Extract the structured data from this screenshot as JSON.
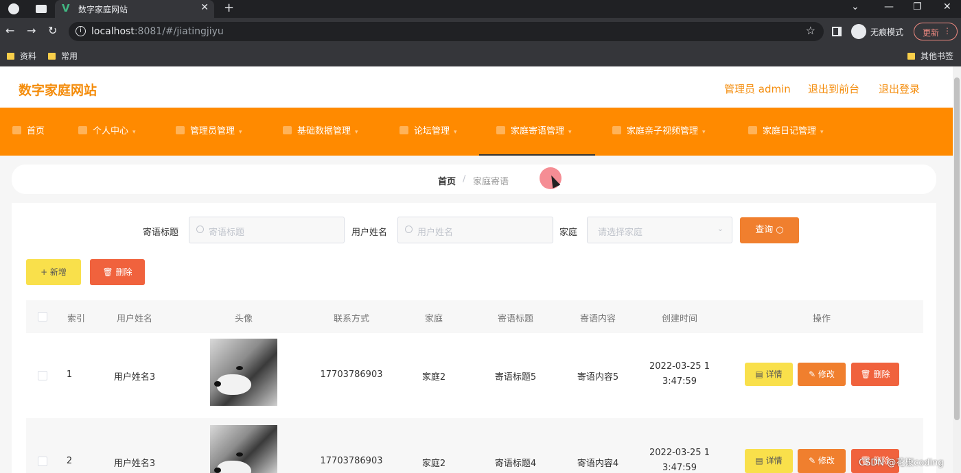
{
  "browser": {
    "tab_title": "数字家庭网站",
    "tab_close": "✕",
    "new_tab": "+",
    "url_host": "localhost",
    "url_rest": ":8081/#/jiatingjiyu",
    "incognito_label": "无痕模式",
    "update_label": "更新",
    "bookmarks": [
      "资料",
      "常用"
    ],
    "other_bookmarks": "其他书签"
  },
  "header": {
    "site_title": "数字家庭网站",
    "admin_label": "管理员 admin",
    "back_to_front": "退出到前台",
    "logout": "退出登录"
  },
  "menu": {
    "items": [
      {
        "label": "首页"
      },
      {
        "label": "个人中心"
      },
      {
        "label": "管理员管理"
      },
      {
        "label": "基础数据管理"
      },
      {
        "label": "论坛管理"
      },
      {
        "label": "家庭寄语管理"
      },
      {
        "label": "家庭亲子视频管理"
      },
      {
        "label": "家庭日记管理"
      }
    ],
    "active_index": 5
  },
  "breadcrumb": {
    "home": "首页",
    "separator": "/",
    "current": "家庭寄语"
  },
  "filters": {
    "title_label": "寄语标题",
    "title_placeholder": "寄语标题",
    "user_label": "用户姓名",
    "user_placeholder": "用户姓名",
    "family_label": "家庭",
    "family_placeholder": "请选择家庭",
    "query_button": "查询 ○"
  },
  "actions": {
    "add_button": "+ 新增",
    "delete_button": "🗑 删除"
  },
  "table": {
    "columns": [
      "索引",
      "用户姓名",
      "头像",
      "联系方式",
      "家庭",
      "寄语标题",
      "寄语内容",
      "创建时间",
      "操作"
    ],
    "rows": [
      {
        "index": "1",
        "user": "用户姓名3",
        "phone": "17703786903",
        "family": "家庭2",
        "title": "寄语标题5",
        "content": "寄语内容5",
        "created": "2022-03-25 13:47:59"
      },
      {
        "index": "2",
        "user": "用户姓名3",
        "phone": "17703786903",
        "family": "家庭2",
        "title": "寄语标题4",
        "content": "寄语内容4",
        "created": "2022-03-25 13:47:59"
      }
    ],
    "row_actions": {
      "detail": "▤ 详情",
      "edit": "✎ 修改",
      "delete": "🗑 删除"
    }
  },
  "watermark": "CSDN @花椒coding"
}
